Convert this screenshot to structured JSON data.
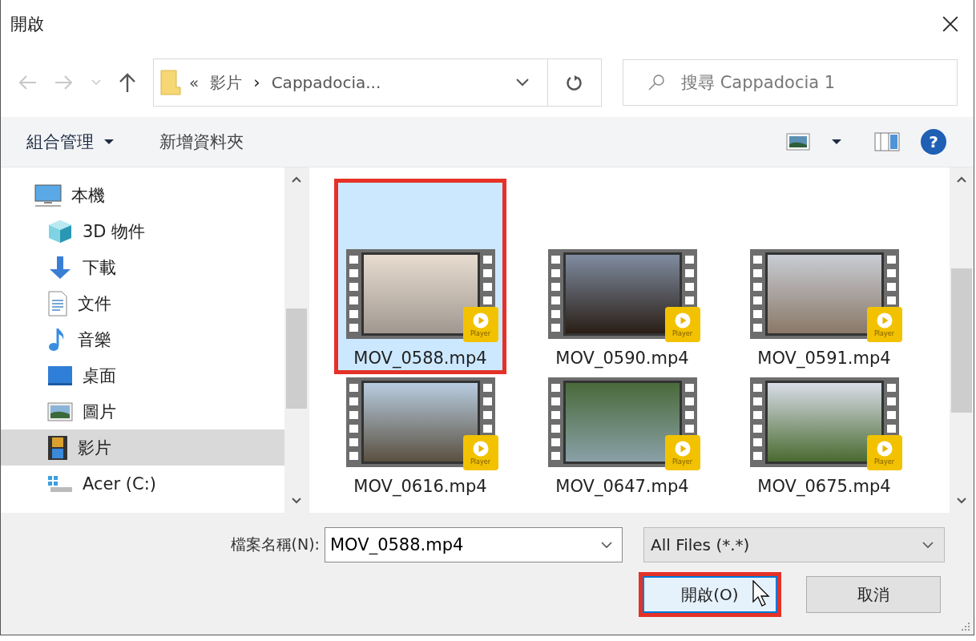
{
  "window": {
    "title": "開啟"
  },
  "nav": {
    "back_disabled": true,
    "forward_disabled": true,
    "breadcrumb": [
      "«",
      "影片",
      "›",
      "Cappadocia..."
    ],
    "search": {
      "placeholder": "搜尋 Cappadocia 1"
    }
  },
  "toolbar": {
    "organize": "組合管理",
    "new_folder": "新增資料夾",
    "help": "?"
  },
  "sidebar": {
    "items": [
      {
        "label": "本機",
        "kind": "computer",
        "selected": false,
        "children": [
          {
            "label": "3D 物件",
            "kind": "cube",
            "selected": false
          },
          {
            "label": "下載",
            "kind": "download",
            "selected": false
          },
          {
            "label": "文件",
            "kind": "document",
            "selected": false
          },
          {
            "label": "音樂",
            "kind": "music",
            "selected": false
          },
          {
            "label": "桌面",
            "kind": "desktop",
            "selected": false
          },
          {
            "label": "圖片",
            "kind": "pictures",
            "selected": false
          },
          {
            "label": "影片",
            "kind": "videos",
            "selected": true
          },
          {
            "label": "Acer (C:)",
            "kind": "drive",
            "selected": false
          }
        ]
      }
    ]
  },
  "files": [
    {
      "name": "MOV_0588.mp4",
      "badge": "Player",
      "selected": true,
      "highlighted": true
    },
    {
      "name": "MOV_0590.mp4",
      "badge": "Player",
      "selected": false,
      "highlighted": false
    },
    {
      "name": "MOV_0591.mp4",
      "badge": "Player",
      "selected": false,
      "highlighted": false
    },
    {
      "name": "MOV_0616.mp4",
      "badge": "Player",
      "selected": false,
      "highlighted": false
    },
    {
      "name": "MOV_0647.mp4",
      "badge": "Player",
      "selected": false,
      "highlighted": false
    },
    {
      "name": "MOV_0675.mp4",
      "badge": "Player",
      "selected": false,
      "highlighted": false
    }
  ],
  "footer": {
    "filename_label": "檔案名稱(N):",
    "filename_value": "MOV_0588.mp4",
    "file_type": "All Files (*.*)",
    "buttons": [
      {
        "label": "開啟(O)",
        "kind": "primary",
        "highlighted": true
      },
      {
        "label": "取消",
        "kind": "cancel",
        "highlighted": false
      }
    ]
  }
}
